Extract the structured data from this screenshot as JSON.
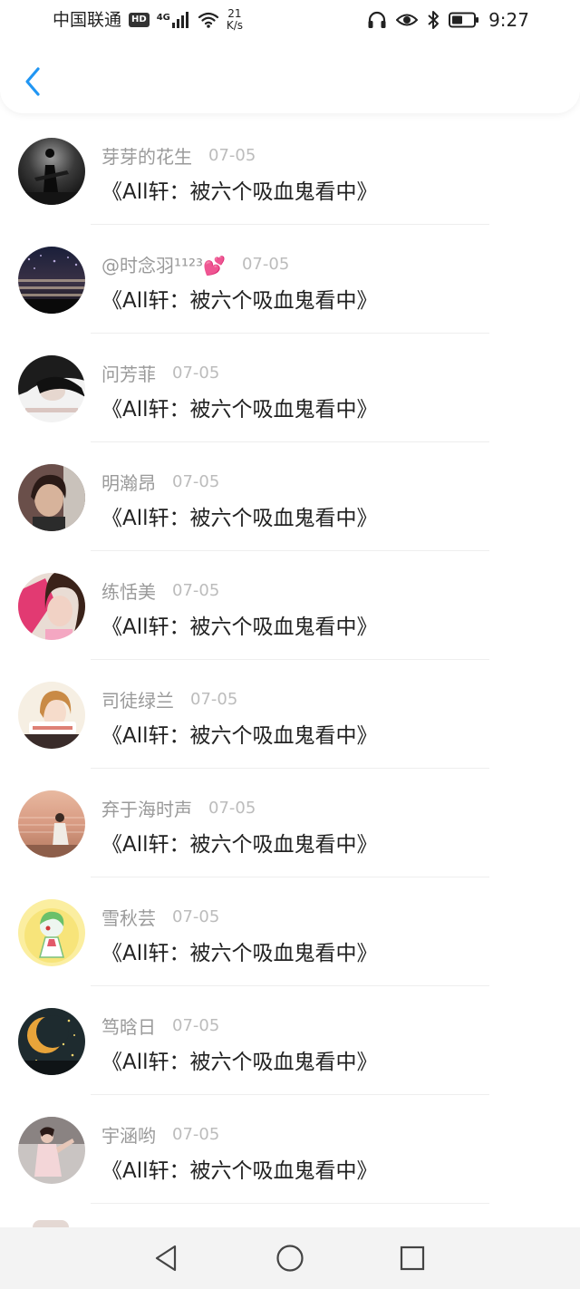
{
  "status_bar": {
    "carrier": "中国联通",
    "hd_badge": "HD",
    "network_type": "4G",
    "speed_value": "21",
    "speed_unit": "K/s",
    "time": "9:27",
    "icons": [
      "headphones-icon",
      "eye-icon",
      "bluetooth-icon",
      "battery-icon"
    ]
  },
  "nav": {
    "back_icon": "chevron-left-icon",
    "accent_color": "#2196F3"
  },
  "list": {
    "items": [
      {
        "username": "芽芽的花生",
        "date": "07-05",
        "message": "《All轩：被六个吸血鬼看中》"
      },
      {
        "username": "@时念羽¹¹²³💕",
        "date": "07-05",
        "message": "《All轩：被六个吸血鬼看中》"
      },
      {
        "username": "问芳菲",
        "date": "07-05",
        "message": "《All轩：被六个吸血鬼看中》"
      },
      {
        "username": "明瀚昂",
        "date": "07-05",
        "message": "《All轩：被六个吸血鬼看中》"
      },
      {
        "username": "练恬美",
        "date": "07-05",
        "message": "《All轩：被六个吸血鬼看中》"
      },
      {
        "username": "司徒绿兰",
        "date": "07-05",
        "message": "《All轩：被六个吸血鬼看中》"
      },
      {
        "username": "弃于海时声",
        "date": "07-05",
        "message": "《All轩：被六个吸血鬼看中》"
      },
      {
        "username": "雪秋芸",
        "date": "07-05",
        "message": "《All轩：被六个吸血鬼看中》"
      },
      {
        "username": "笃晗日",
        "date": "07-05",
        "message": "《All轩：被六个吸血鬼看中》"
      },
      {
        "username": "宇涵哟",
        "date": "07-05",
        "message": "《All轩：被六个吸血鬼看中》"
      }
    ]
  },
  "system_nav": {
    "buttons": [
      "back-triangle-icon",
      "home-circle-icon",
      "recents-square-icon"
    ]
  }
}
